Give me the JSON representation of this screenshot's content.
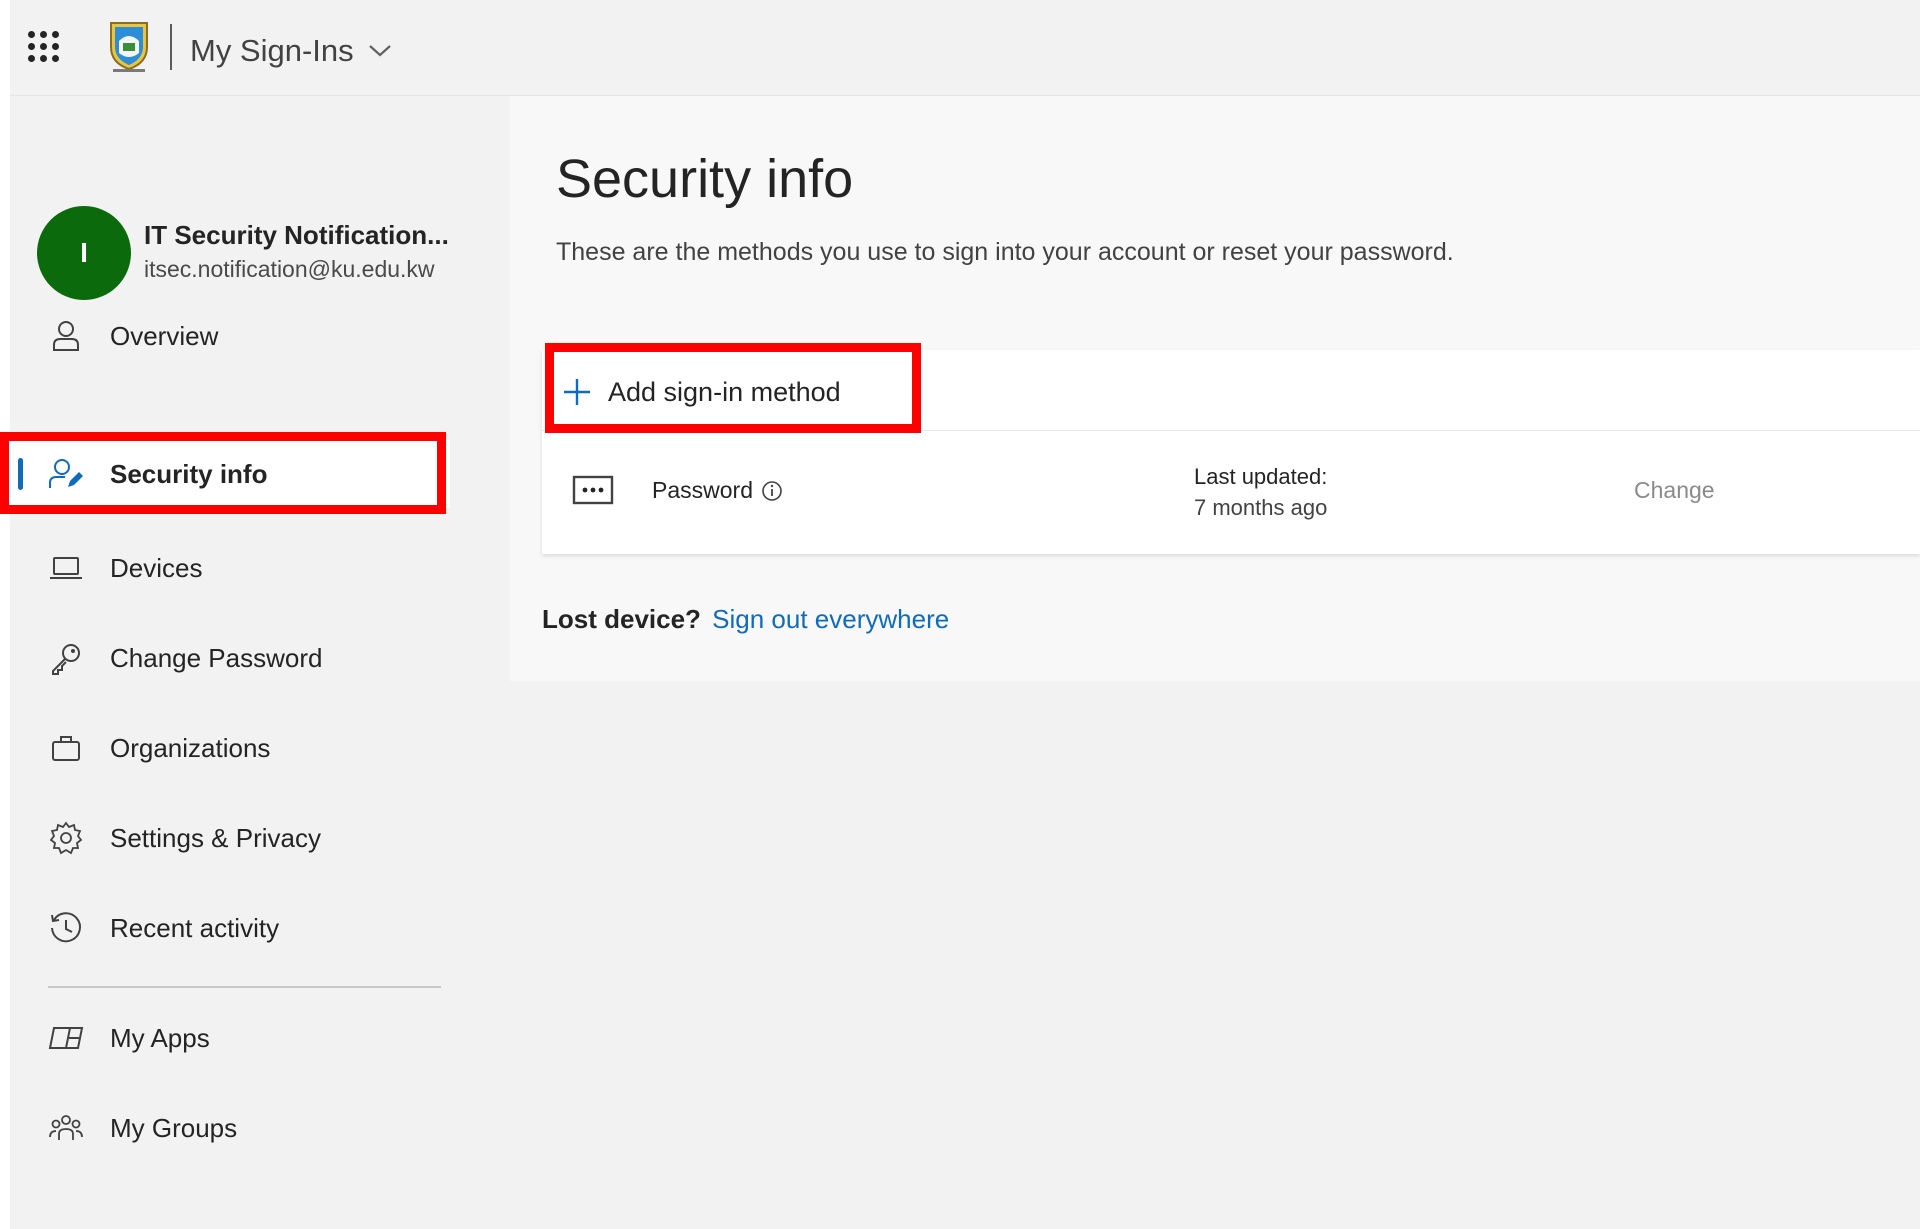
{
  "header": {
    "app_title": "My Sign-Ins"
  },
  "user": {
    "initial": "I",
    "name": "IT Security Notification...",
    "email": "itsec.notification@ku.edu.kw"
  },
  "sidebar": {
    "items": [
      {
        "label": "Overview",
        "icon": "person-icon"
      },
      {
        "label": "Security info",
        "icon": "person-edit-icon",
        "active": true
      },
      {
        "label": "Devices",
        "icon": "laptop-icon"
      },
      {
        "label": "Change Password",
        "icon": "key-icon"
      },
      {
        "label": "Organizations",
        "icon": "briefcase-icon"
      },
      {
        "label": "Settings & Privacy",
        "icon": "gear-icon"
      },
      {
        "label": "Recent activity",
        "icon": "history-icon"
      }
    ],
    "secondary_items": [
      {
        "label": "My Apps",
        "icon": "apps-icon"
      },
      {
        "label": "My Groups",
        "icon": "people-group-icon"
      }
    ]
  },
  "main": {
    "title": "Security info",
    "description": "These are the methods you use to sign into your account or reset your password.",
    "add_method_label": "Add sign-in method",
    "methods": [
      {
        "name": "Password",
        "last_updated_label": "Last updated:",
        "last_updated_value": "7 months ago",
        "action": "Change"
      }
    ],
    "lost_device_question": "Lost device?",
    "lost_device_link": "Sign out everywhere"
  },
  "colors": {
    "accent": "#0f6cbd",
    "avatar": "#0b6a0b",
    "highlight": "#ff0000"
  }
}
